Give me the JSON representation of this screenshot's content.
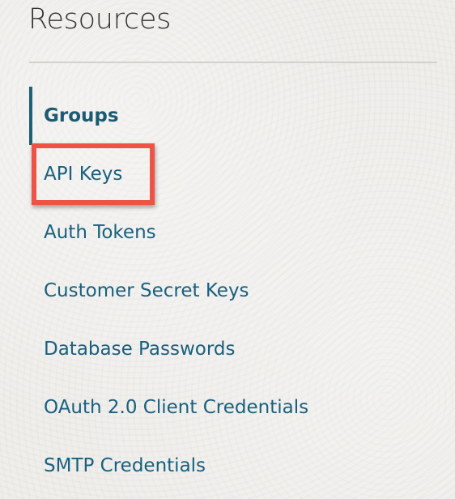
{
  "section_title": "Resources",
  "nav": {
    "items": [
      {
        "label": "Groups",
        "active": true
      },
      {
        "label": "API Keys",
        "active": false,
        "highlighted": true
      },
      {
        "label": "Auth Tokens",
        "active": false
      },
      {
        "label": "Customer Secret Keys",
        "active": false
      },
      {
        "label": "Database Passwords",
        "active": false
      },
      {
        "label": "OAuth 2.0 Client Credentials",
        "active": false
      },
      {
        "label": "SMTP Credentials",
        "active": false
      }
    ]
  },
  "colors": {
    "background": "#efeeeb",
    "link": "#19607f",
    "active_indicator": "#1f5f78",
    "highlight": "#ef5346",
    "title": "#333333"
  }
}
